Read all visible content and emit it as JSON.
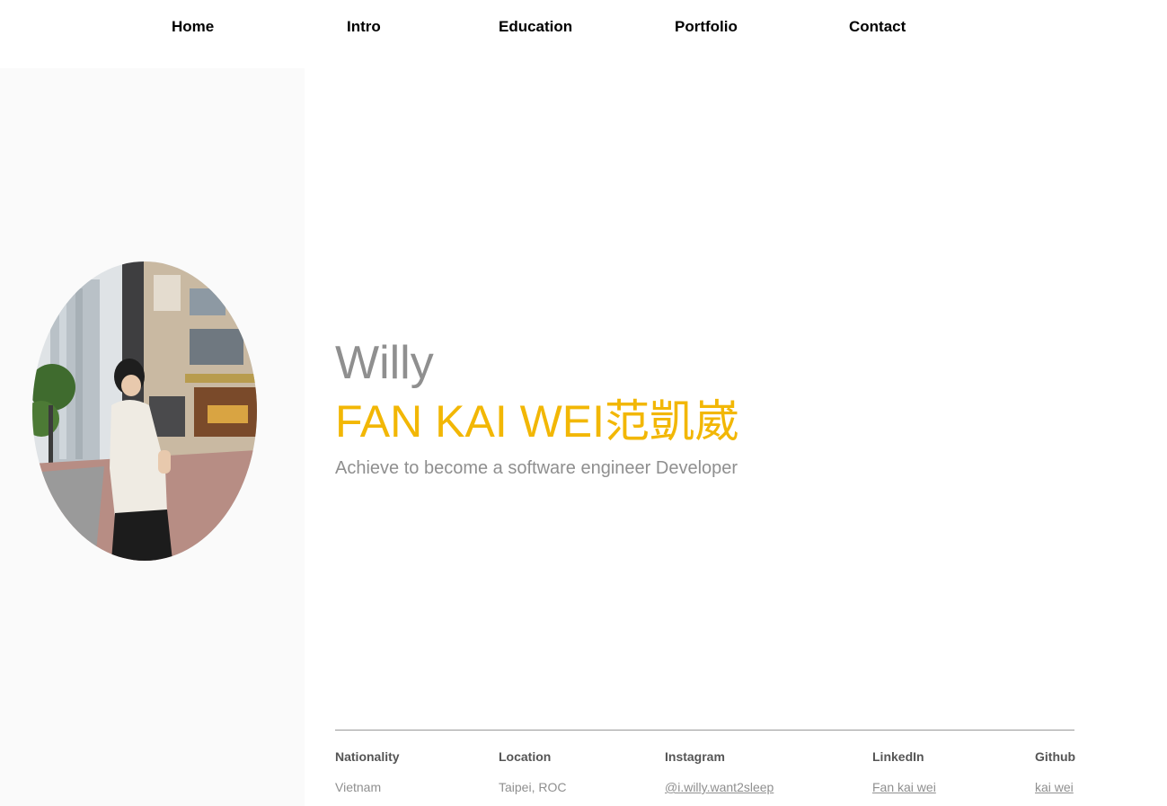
{
  "nav": {
    "items": [
      {
        "label": "Home"
      },
      {
        "label": "Intro"
      },
      {
        "label": "Education"
      },
      {
        "label": "Portfolio"
      },
      {
        "label": "Contact"
      }
    ]
  },
  "profile": {
    "photo_alt": "Portrait photo",
    "nickname": "Willy",
    "full_name": "FAN KAI WEI范凱崴",
    "tagline": "Achieve to become a software engineer Developer"
  },
  "info": {
    "nationality": {
      "label": "Nationality",
      "value": "Vietnam"
    },
    "location": {
      "label": "Location",
      "value": "Taipei, ROC"
    },
    "instagram": {
      "label": "Instagram",
      "value": "@i.willy.want2sleep"
    },
    "linkedin": {
      "label": "LinkedIn",
      "value": "Fan kai wei"
    },
    "github": {
      "label": "Github",
      "value": "kai wei"
    }
  },
  "colors": {
    "accent": "#f2b705",
    "muted_text": "#8f8f8f",
    "sidebar_bg": "#fafafa"
  }
}
